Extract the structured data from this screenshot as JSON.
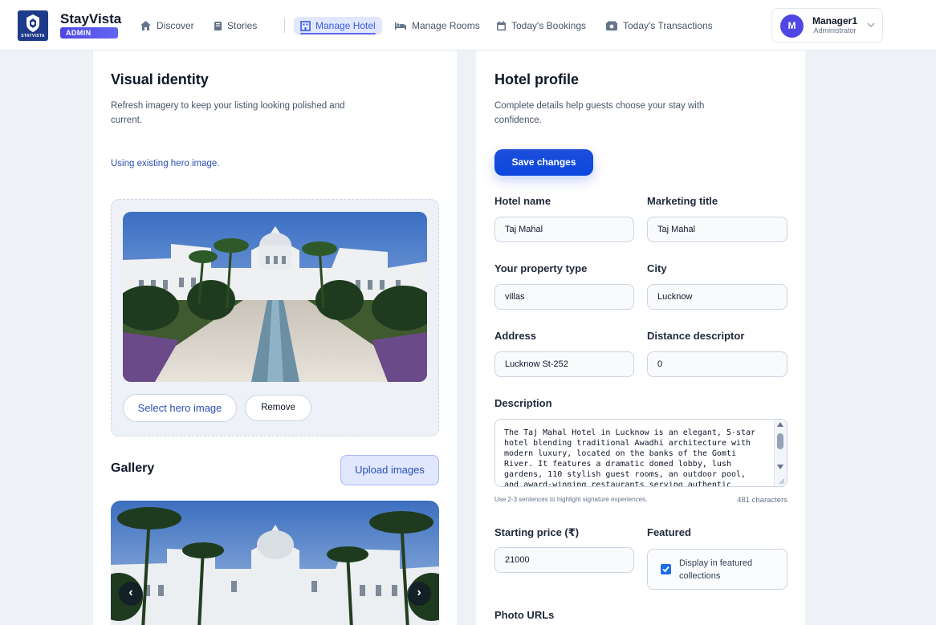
{
  "brand": {
    "name": "StayVista",
    "badge": "ADMIN",
    "logo_text": "STAYVISTA"
  },
  "nav": {
    "items": [
      {
        "label": "Discover",
        "icon": "home-icon"
      },
      {
        "label": "Stories",
        "icon": "book-icon"
      },
      {
        "label": "Manage Hotel",
        "icon": "hotel-icon",
        "active": true
      },
      {
        "label": "Manage Rooms",
        "icon": "bed-icon"
      },
      {
        "label": "Today's Bookings",
        "icon": "calendar-icon"
      },
      {
        "label": "Today's Transactions",
        "icon": "wallet-icon"
      }
    ]
  },
  "user": {
    "initial": "M",
    "name": "Manager1",
    "role": "Administrator"
  },
  "visual_identity": {
    "title": "Visual identity",
    "subtitle": "Refresh imagery to keep your listing looking polished and current.",
    "info": "Using existing hero image.",
    "select_label": "Select hero image",
    "remove_label": "Remove"
  },
  "gallery": {
    "title": "Gallery",
    "upload_label": "Upload images",
    "prev": "‹",
    "next": "›"
  },
  "hotel_profile": {
    "title": "Hotel profile",
    "subtitle": "Complete details help guests choose your stay with confidence.",
    "save_label": "Save changes",
    "fields": {
      "hotel_name": {
        "label": "Hotel name",
        "value": "Taj Mahal"
      },
      "marketing_title": {
        "label": "Marketing title",
        "value": "Taj Mahal"
      },
      "property_type": {
        "label": "Your property type",
        "value": "villas"
      },
      "city": {
        "label": "City",
        "value": "Lucknow"
      },
      "address": {
        "label": "Address",
        "value": "Lucknow St-252"
      },
      "distance": {
        "label": "Distance descriptor",
        "value": "0"
      },
      "description": {
        "label": "Description",
        "value": "The Taj Mahal Hotel in Lucknow is an elegant, 5-star\nhotel blending traditional Awadhi architecture with\nmodern luxury, located on the banks of the Gomti\nRiver. It features a dramatic domed lobby, lush\ngardens, 110 stylish guest rooms, an outdoor pool,\nand award-winning restaurants serving authentic",
        "hint": "Use 2-3 sentences to highlight signature experiences.",
        "count": "481 characters"
      },
      "starting_price": {
        "label": "Starting price (₹)",
        "value": "21000"
      },
      "featured": {
        "label": "Featured",
        "checkbox_label": "Display in featured collections",
        "checked": true
      },
      "photo_urls": {
        "label": "Photo URLs"
      }
    }
  },
  "colors": {
    "primary": "#1d4ed8",
    "accent": "#6366f1",
    "brand_navy": "#1e3a8a"
  }
}
